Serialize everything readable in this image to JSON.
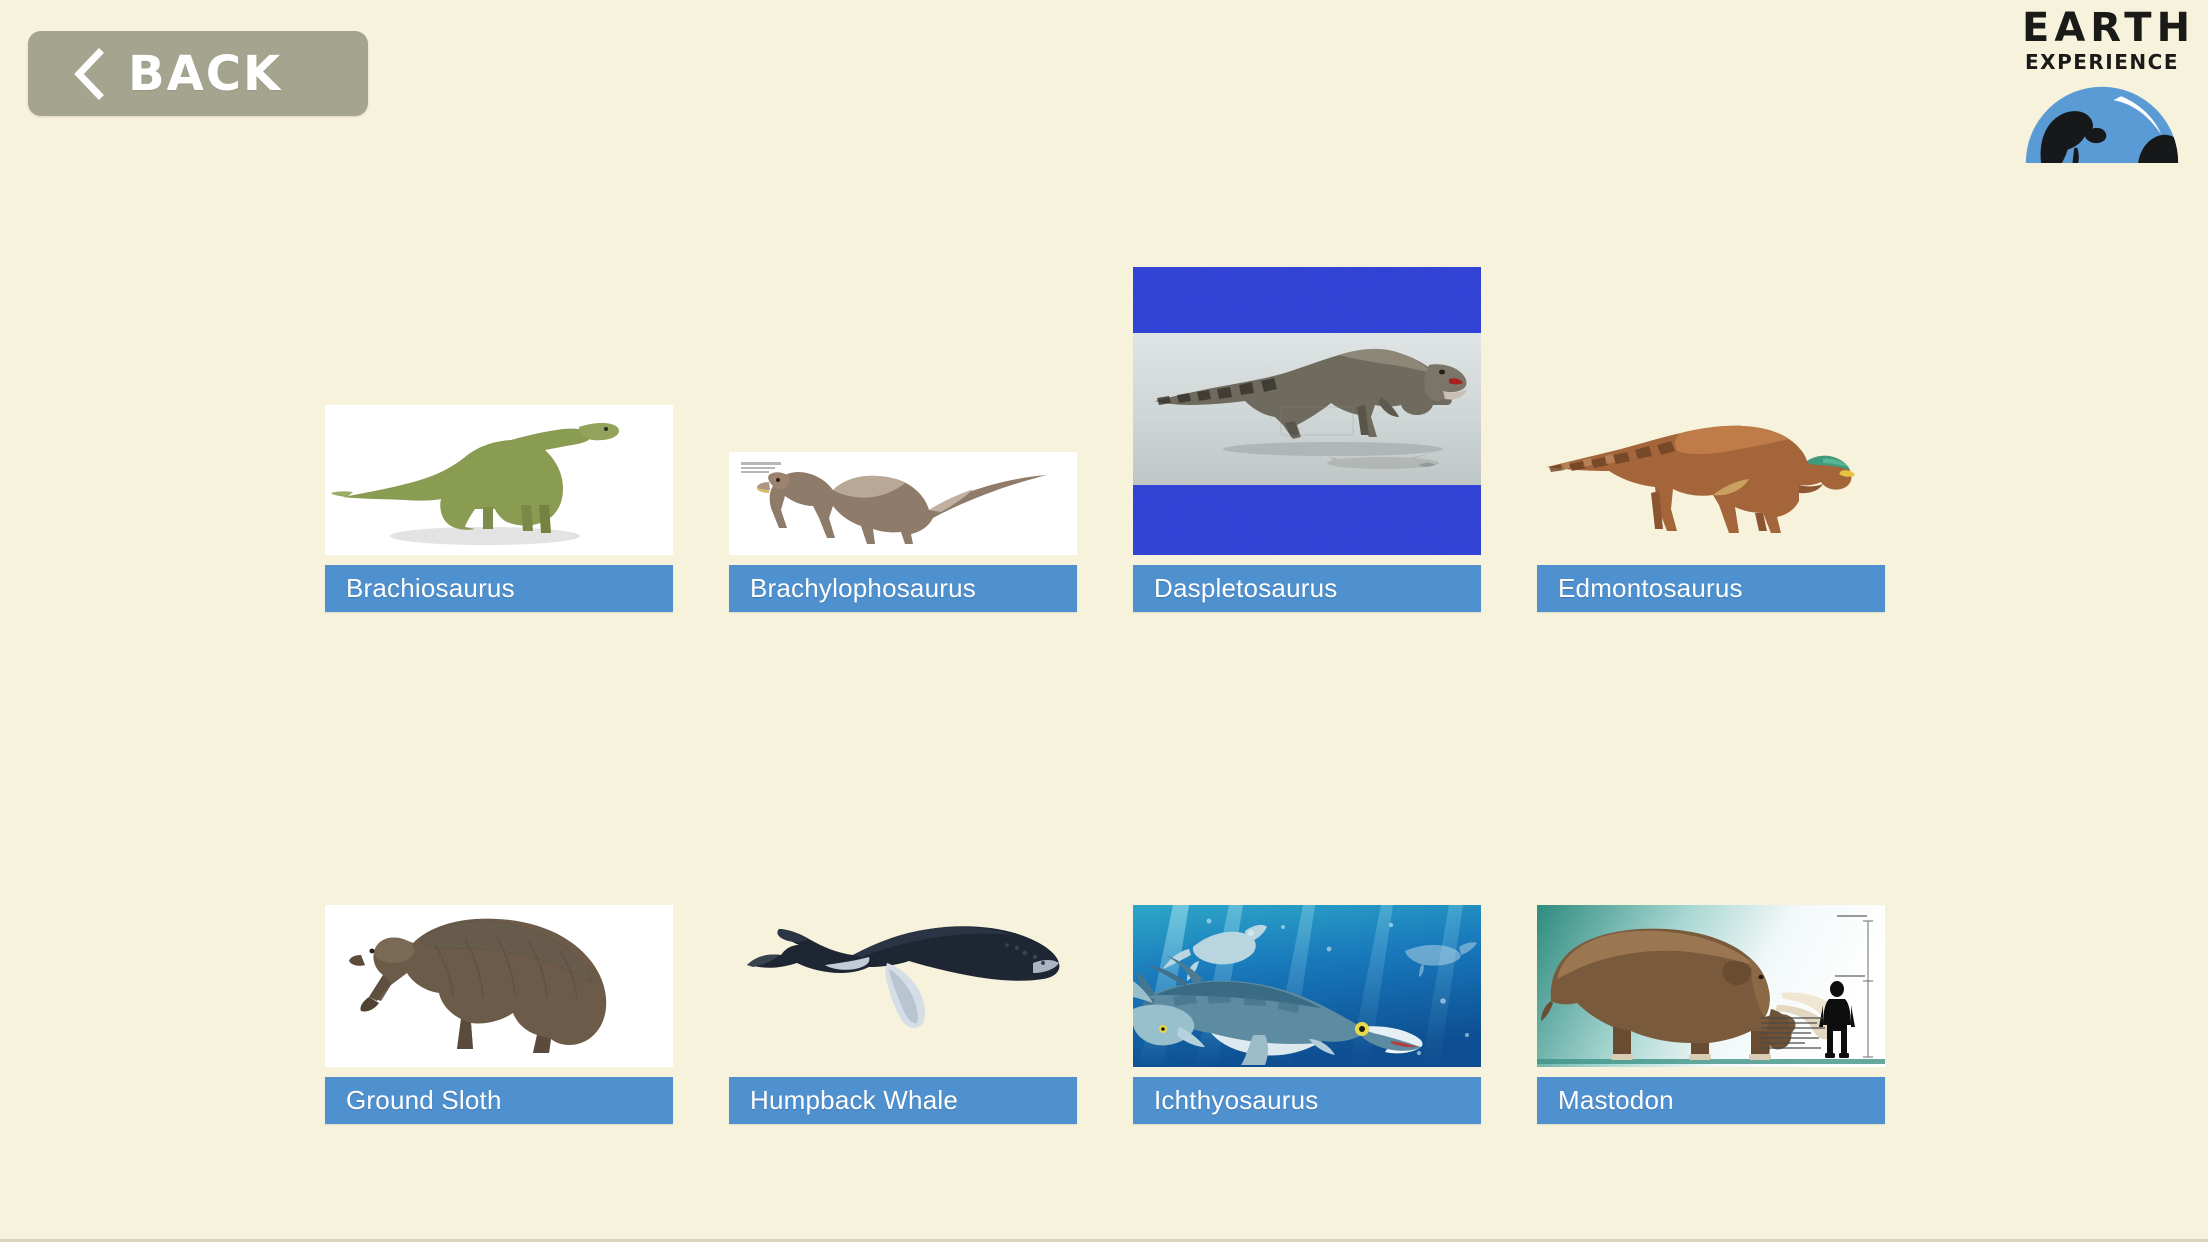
{
  "header": {
    "back_button": {
      "label": "BACK",
      "icon": "chevron-left-icon",
      "bg_color": "#a5a48e"
    },
    "logo": {
      "line1": "EARTH",
      "line2": "EXPERIENCE",
      "dome_color": "#5b9bd5"
    }
  },
  "theme": {
    "page_background": "#f7f2dc",
    "label_bar_color": "#4f91cf",
    "label_text_color": "#ffffff",
    "daspletosaurus_letterbox_color": "#2b3fd6"
  },
  "grid": {
    "columns": 4,
    "rows": 2,
    "cards": [
      {
        "id": "brachiosaurus",
        "label": "Brachiosaurus",
        "thumb_background": "white",
        "subject": "green long-necked sauropod with cast shadow"
      },
      {
        "id": "brachylophosaurus",
        "label": "Brachylophosaurus",
        "thumb_background": "white",
        "subject": "brown striped hadrosaur walking, small watermark top-left"
      },
      {
        "id": "daspletosaurus",
        "label": "Daspletosaurus",
        "thumb_background": "royal-blue-letterbox",
        "subject": "roaring tyrannosaurid on reflective grey floor"
      },
      {
        "id": "edmontosaurus",
        "label": "Edmontosaurus",
        "thumb_background": "transparent",
        "subject": "brown hadrosaur with green-teal head"
      },
      {
        "id": "ground-sloth",
        "label": "Ground Sloth",
        "thumb_background": "white",
        "subject": "shaggy brown giant ground sloth on all fours"
      },
      {
        "id": "humpback-whale",
        "label": "Humpback Whale",
        "thumb_background": "transparent",
        "subject": "dark navy humpback whale with white flippers"
      },
      {
        "id": "ichthyosaurus",
        "label": "Ichthyosaurus",
        "thumb_background": "underwater-scene",
        "subject": "pod of ichthyosaurs in blue water with light rays"
      },
      {
        "id": "mastodon",
        "label": "Mastodon",
        "thumb_background": "teal-white-gradient",
        "subject": "mastodon size comparison with human silhouette"
      }
    ]
  }
}
